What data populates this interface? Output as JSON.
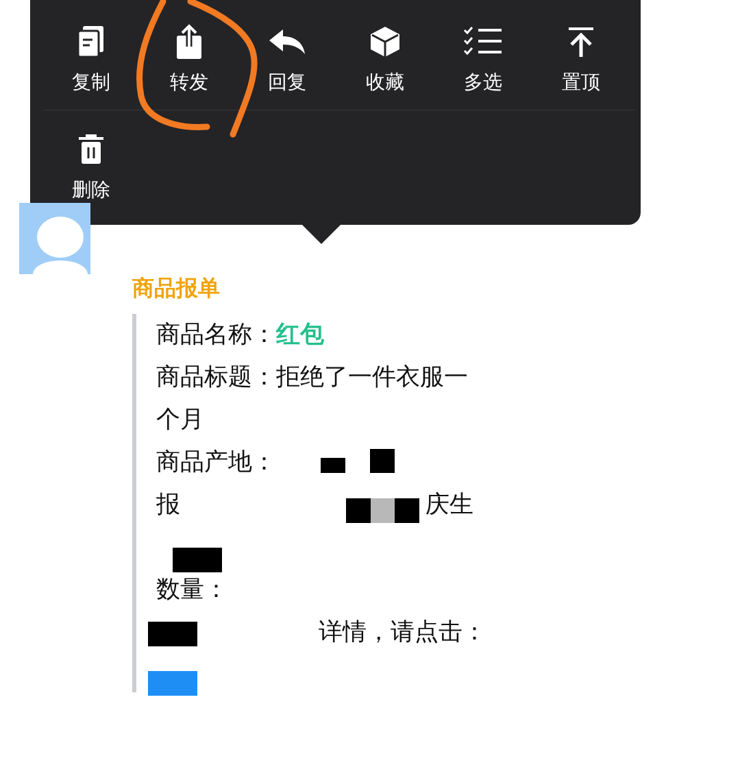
{
  "context_menu": {
    "rows": [
      [
        "复制",
        "转发",
        "回复",
        "收藏",
        "多选",
        "置顶"
      ],
      [
        "删除"
      ]
    ]
  },
  "message": {
    "title": "商品报单",
    "lines": [
      {
        "label": "商品名称：",
        "value": "红包"
      },
      {
        "label": "商品标题：",
        "value": "拒绝了一件衣服一个月"
      },
      {
        "label": "商品产地："
      },
      {
        "label": "报",
        "value": "庆生"
      },
      {
        "label": "数量："
      },
      {
        "label": "详情，请点击："
      }
    ]
  }
}
